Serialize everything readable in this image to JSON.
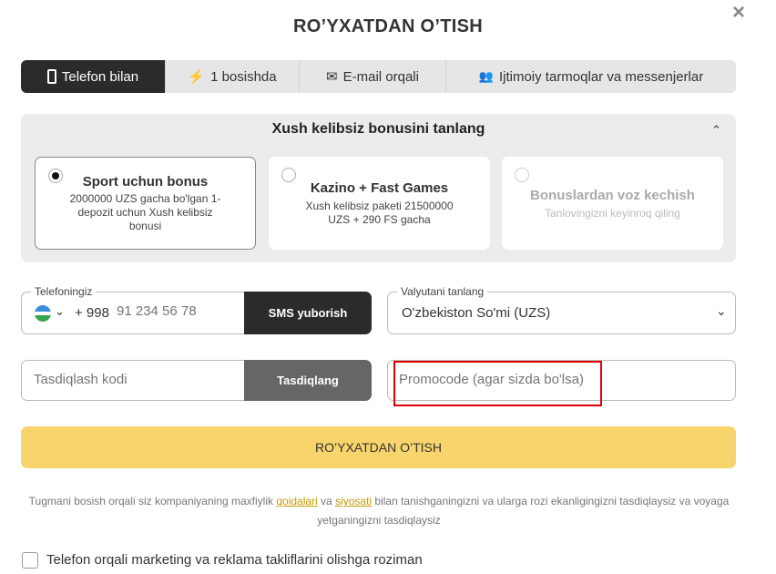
{
  "title": "RO’YXATDAN O’TISH",
  "close_icon": "×",
  "tabs": [
    {
      "label": "Telefon bilan",
      "icon": "phone-icon",
      "active": true
    },
    {
      "label": "1 bosishda",
      "icon": "lightning-icon"
    },
    {
      "label": "E-mail orqali",
      "icon": "envelope-icon"
    },
    {
      "label": "Ijtimoiy tarmoqlar va messenjerlar",
      "icon": "users-icon"
    }
  ],
  "bonus": {
    "title": "Xush kelibsiz bonusini tanlang",
    "options": [
      {
        "title": "Sport uchun bonus",
        "desc": "2000000 UZS gacha bo'lgan 1-depozit uchun Xush kelibsiz bonusi",
        "selected": true
      },
      {
        "title": "Kazino + Fast Games",
        "desc": "Xush kelibsiz paketi 21500000 UZS + 290 FS gacha",
        "selected": false
      },
      {
        "title": "Bonuslardan voz kechish",
        "desc": "Tanlovingizni keyinroq qiling",
        "selected": false
      }
    ]
  },
  "phone": {
    "label": "Telefoningiz",
    "prefix": "+ 998",
    "placeholder": "91 234 56 78",
    "button": "SMS yuborish"
  },
  "currency": {
    "label": "Valyutani tanlang",
    "value": "O'zbekiston So'mi (UZS)"
  },
  "code": {
    "placeholder": "Tasdiqlash kodi",
    "button": "Tasdiqlang"
  },
  "promo": {
    "placeholder": "Promocode (agar sizda bo'lsa)"
  },
  "submit": "RO’YXATDAN O’TISH",
  "legal": {
    "before": "Tugmani bosish orqali siz kompaniyaning maxfiylik ",
    "link1": "qoidalari",
    "mid": " va ",
    "link2": "siyosati",
    "after": " bilan tanishganingizni va ularga rozi ekanligingizni tasdiqlaysiz va voyaga yetganingizni tasdiqlaysiz"
  },
  "marketing_checkbox": "Telefon orqali marketing va reklama takliflarini olishga roziman",
  "colors": {
    "accent": "#f8d56c",
    "dark": "#2b2b2b",
    "highlight": "#e00000"
  }
}
